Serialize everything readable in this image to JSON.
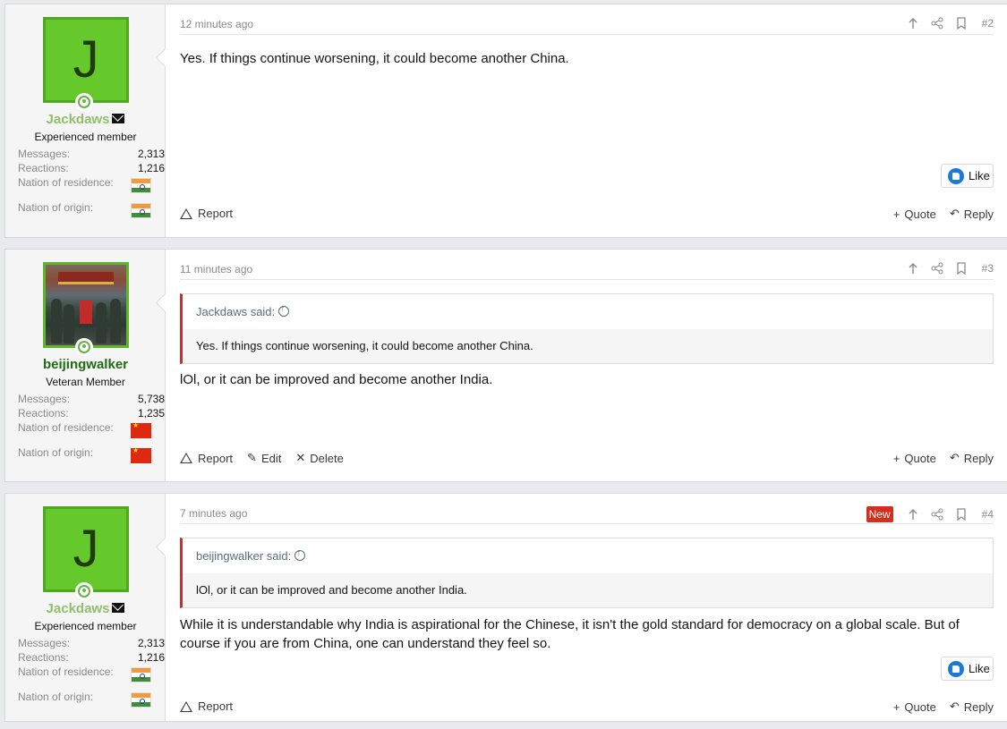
{
  "posts": [
    {
      "user": {
        "name": "Jackdaws",
        "initial": "J",
        "title": "Experienced member",
        "messages_label": "Messages:",
        "messages": "2,313",
        "reactions_label": "Reactions:",
        "reactions": "1,216",
        "residence_label": "Nation of residence:",
        "origin_label": "Nation of origin:"
      },
      "time": "12 minutes ago",
      "number": "#2",
      "text": "Yes. If things continue worsening, it could become another China.",
      "like_label": "Like",
      "report_label": "Report",
      "quote_label": "Quote",
      "reply_label": "Reply"
    },
    {
      "user": {
        "name": "beijingwalker",
        "title": "Veteran Member",
        "messages_label": "Messages:",
        "messages": "5,738",
        "reactions_label": "Reactions:",
        "reactions": "1,235",
        "residence_label": "Nation of residence:",
        "origin_label": "Nation of origin:"
      },
      "time": "11 minutes ago",
      "number": "#3",
      "quote": {
        "author": "Jackdaws said:",
        "text": "Yes. If things continue worsening, it could become another China."
      },
      "text": "lOl, or it can be improved and become another India.",
      "report_label": "Report",
      "edit_label": "Edit",
      "delete_label": "Delete",
      "quote_label": "Quote",
      "reply_label": "Reply"
    },
    {
      "user": {
        "name": "Jackdaws",
        "initial": "J",
        "title": "Experienced member",
        "messages_label": "Messages:",
        "messages": "2,313",
        "reactions_label": "Reactions:",
        "reactions": "1,216",
        "residence_label": "Nation of residence:",
        "origin_label": "Nation of origin:"
      },
      "time": "7 minutes ago",
      "new_badge": "New",
      "number": "#4",
      "quote": {
        "author": "beijingwalker said:",
        "text": "lOl, or it can be improved and become another India."
      },
      "text": "While it is understandable why India is aspirational for the Chinese, it isn't the gold standard for democracy on a global scale. But of course if you are from China, one can understand they feel so.",
      "like_label": "Like",
      "report_label": "Report",
      "quote_label": "Quote",
      "reply_label": "Reply"
    }
  ],
  "icons": {
    "share": "share-icon",
    "bookmark": "bookmark-icon",
    "arrow_up": "arrow-up-icon",
    "mail": "mail-icon",
    "like": "like-icon"
  },
  "colors": {
    "accent_red": "#c9302c",
    "new_badge": "#d42f1e",
    "avatar_green": "#65c92b",
    "username_green": "#8fbf6b",
    "username_dark": "#1f6b12",
    "like_blue": "#1a7ad9"
  }
}
